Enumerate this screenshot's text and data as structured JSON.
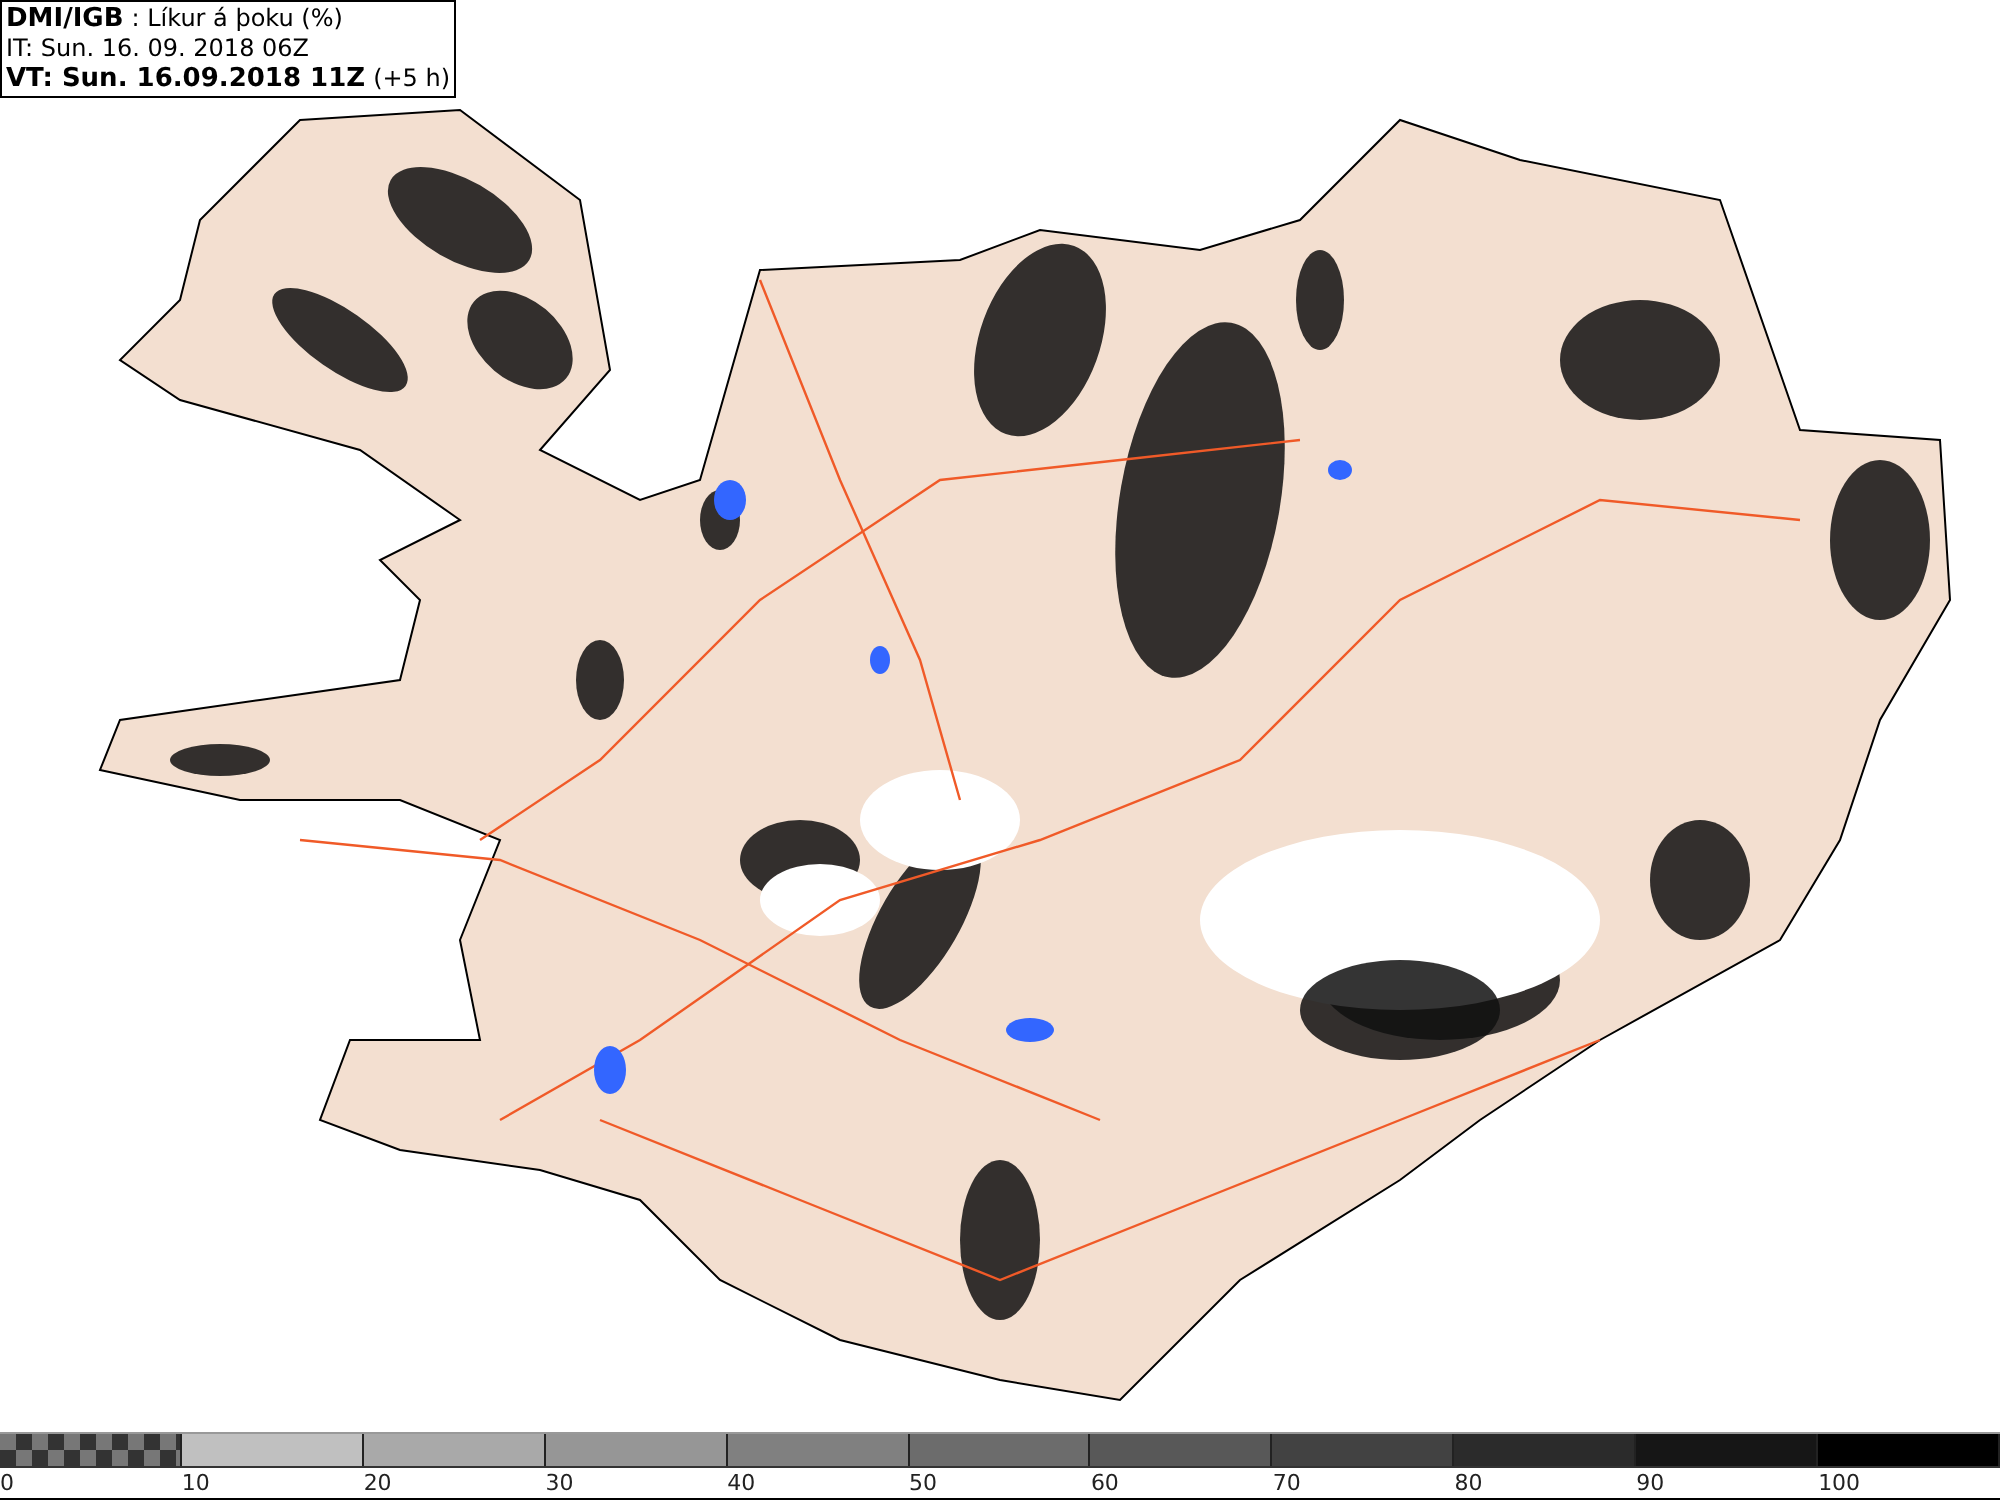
{
  "header": {
    "source": "DMI/IGB",
    "title": ": Líkur á þoku (%)",
    "issue_time": "IT: Sun. 16. 09. 2018 06Z",
    "valid_time": "VT: Sun. 16.09.2018 11Z",
    "offset": "(+5 h)"
  },
  "legend": [
    {
      "label": "0",
      "kind": "checker"
    },
    {
      "label": "10",
      "kind": "solid",
      "color": "#c0c0c0"
    },
    {
      "label": "20",
      "kind": "solid",
      "color": "#a9a9a9"
    },
    {
      "label": "30",
      "kind": "solid",
      "color": "#969696"
    },
    {
      "label": "40",
      "kind": "solid",
      "color": "#808080"
    },
    {
      "label": "50",
      "kind": "solid",
      "color": "#6c6c6c"
    },
    {
      "label": "60",
      "kind": "solid",
      "color": "#585858"
    },
    {
      "label": "70",
      "kind": "solid",
      "color": "#424242"
    },
    {
      "label": "80",
      "kind": "solid",
      "color": "#2b2b2b"
    },
    {
      "label": "90",
      "kind": "solid",
      "color": "#161616"
    },
    {
      "label": "100",
      "kind": "solid",
      "color": "#000000"
    }
  ]
}
